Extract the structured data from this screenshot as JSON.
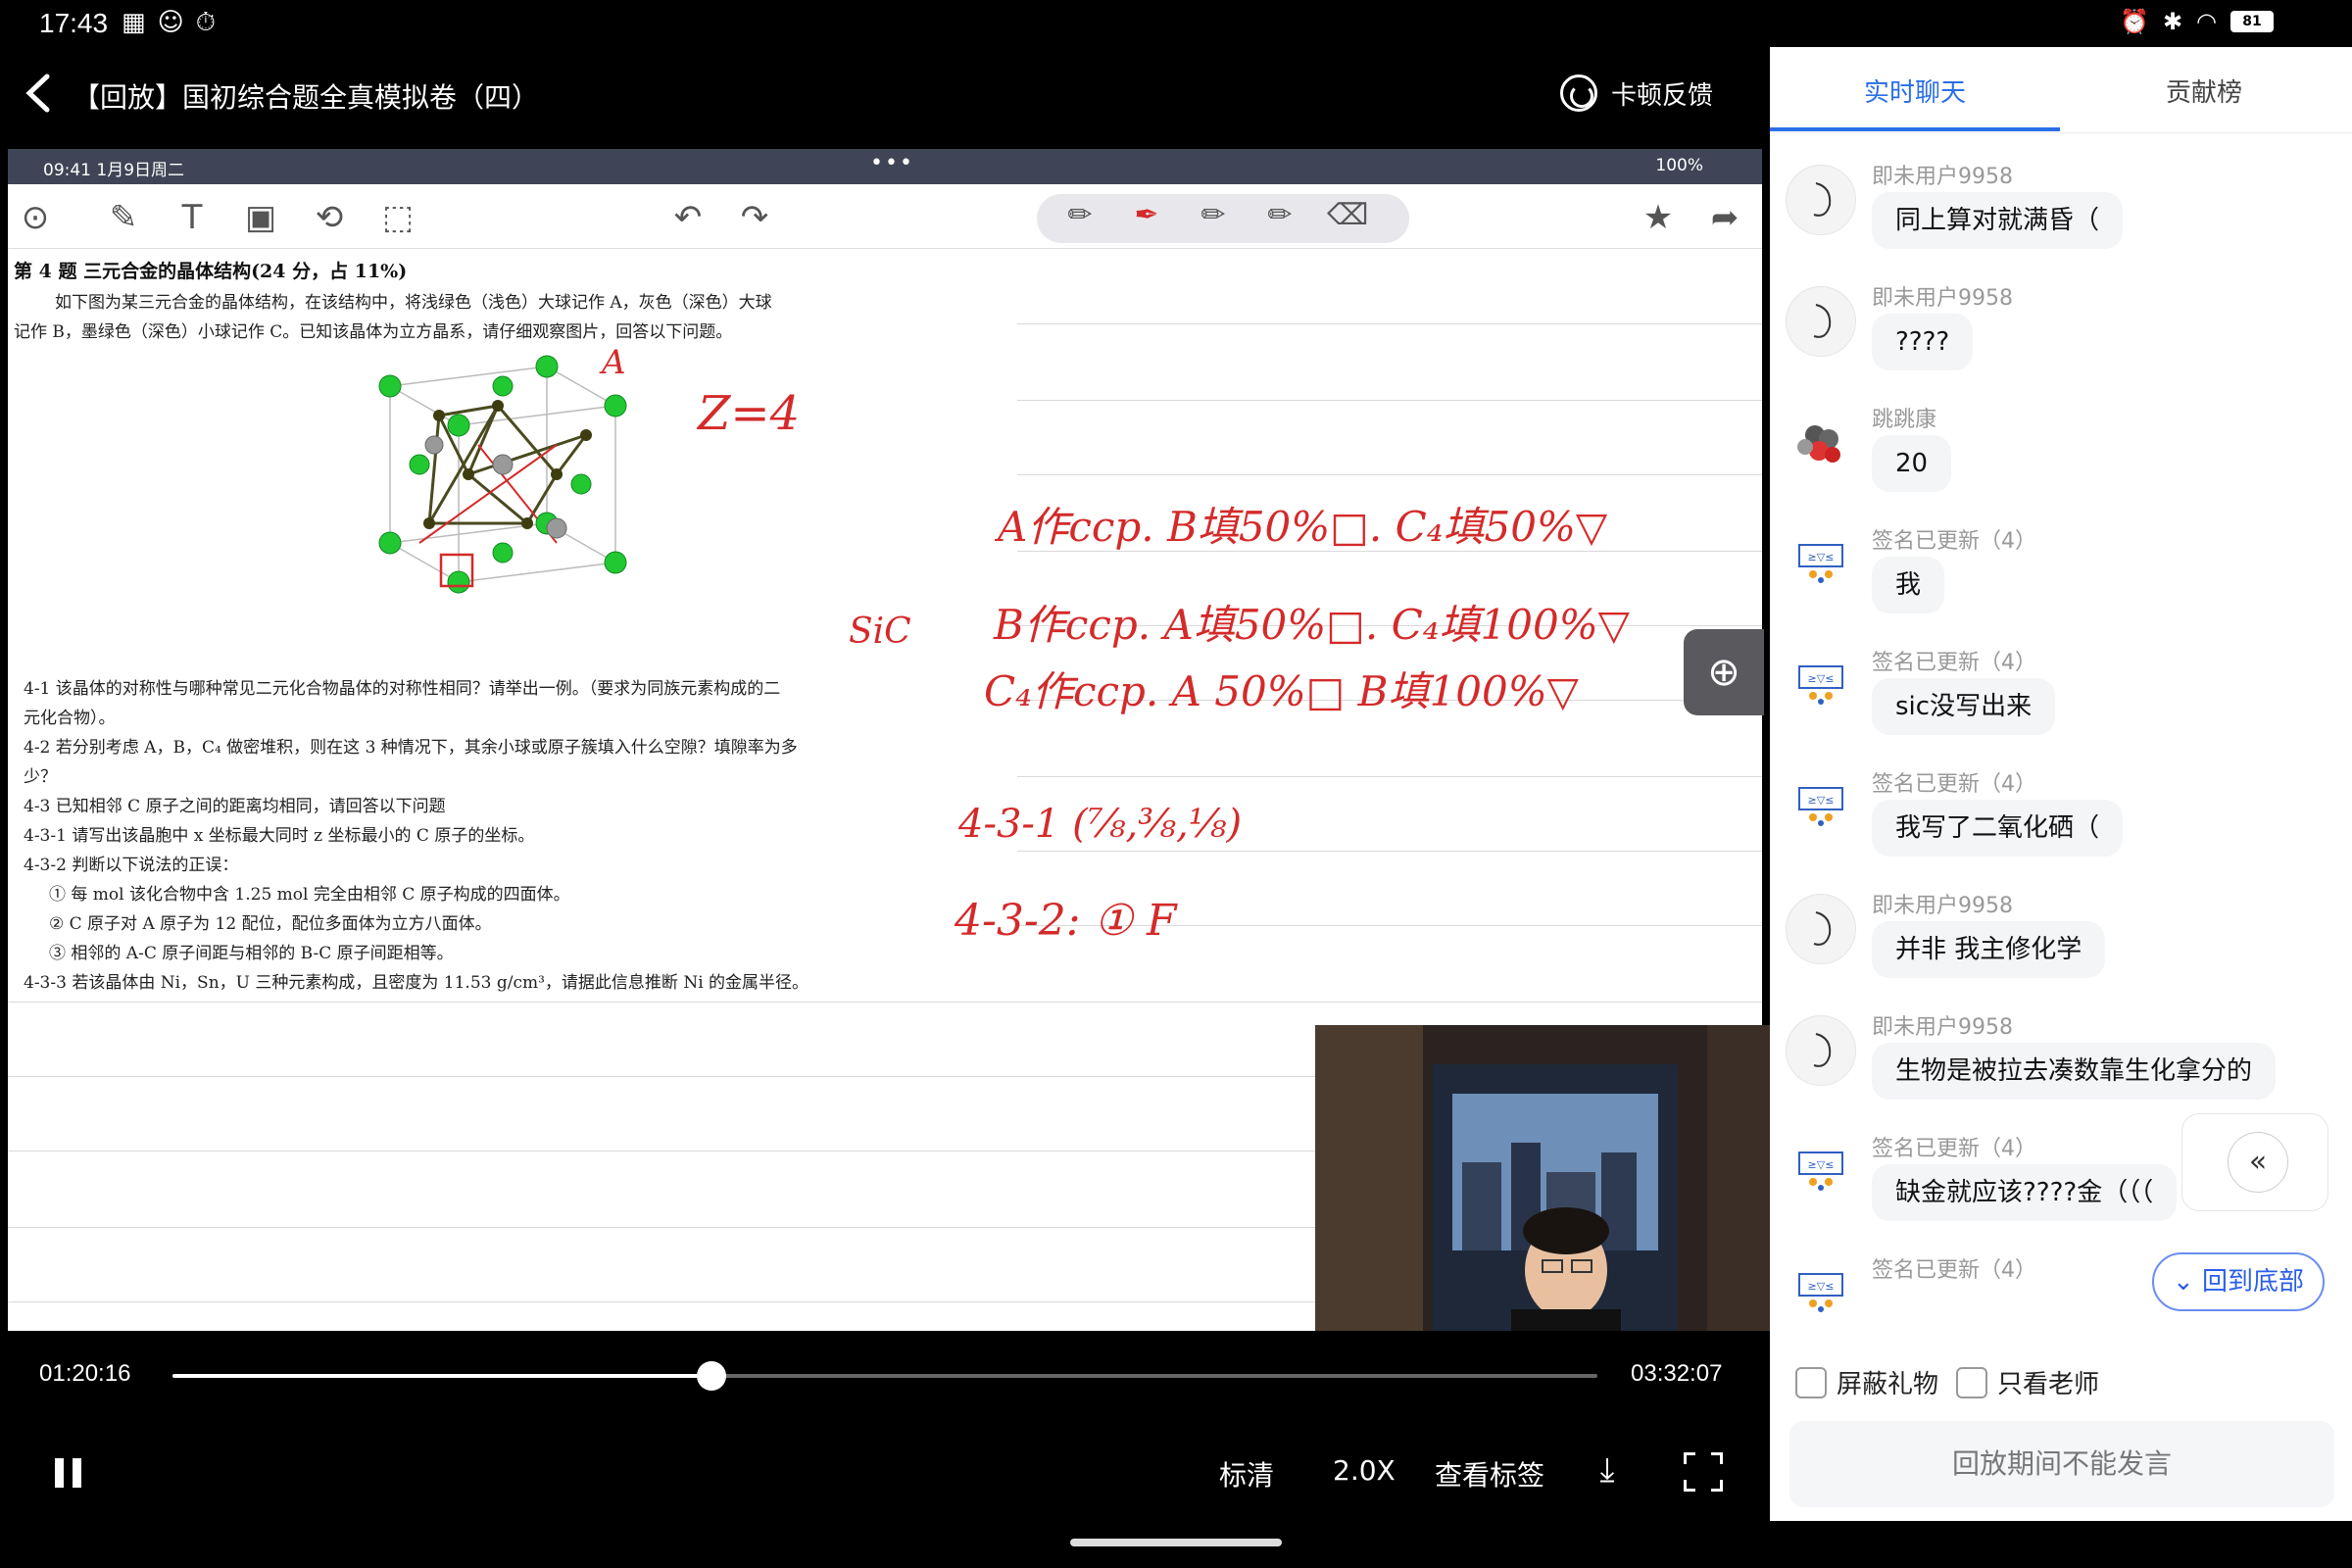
{
  "status": {
    "time": "17:43",
    "battery": "81"
  },
  "header": {
    "title": "【回放】国初综合题全真模拟卷（四）",
    "feedback_label": "卡顿反馈"
  },
  "ipad": {
    "time": "09:41  1月9日周二",
    "battery": "100%"
  },
  "doc": {
    "q_title": "第 4 题  三元合金的晶体结构(24 分，占 11%)",
    "intro_1": "如下图为某三元合金的晶体结构，在该结构中，将浅绿色（浅色）大球记作 A，灰色（深色）大球",
    "intro_2": "记作 B，墨绿色（深色）小球记作 C。已知该晶体为立方晶系，请仔细观察图片，回答以下问题。",
    "q41_a": "4-1  该晶体的对称性与哪种常见二元化合物晶体的对称性相同？请举出一例。（要求为同族元素构成的二",
    "q41_b": "元化合物）。",
    "q42_a": "4-2  若分别考虑 A，B，C₄ 做密堆积，则在这 3 种情况下，其余小球或原子簇填入什么空隙？填隙率为多",
    "q42_b": "少？",
    "q43": "4-3  已知相邻 C 原子之间的距离均相同，请回答以下问题",
    "q431": "4-3-1  请写出该晶胞中 x 坐标最大同时 z 坐标最小的 C 原子的坐标。",
    "q432": "4-3-2  判断以下说法的正误：",
    "q432_1": "① 每 mol 该化合物中含 1.25 mol 完全由相邻 C 原子构成的四面体。",
    "q432_2": "② C 原子对 A 原子为 12 配位，配位多面体为立方八面体。",
    "q432_3": "③ 相邻的 A-C 原子间距与相邻的 B-C 原子间距相等。",
    "q433": "4-3-3  若该晶体由 Ni，Sn，U 三种元素构成，且密度为 11.53 g/cm³，请据此信息推断 Ni 的金属半径。",
    "handwriting": {
      "a_label": "A",
      "z": "Z=4",
      "line1": "A作ccp.  B填50%□.  C₄填50%▽",
      "line2": "B作ccp.  A填50%□.  C₄填100%▽",
      "line3": "C₄作ccp.  A 50%□   B填100%▽",
      "sic": "SiC",
      "ans1": "4-3-1 (⅞,⅜,⅛)",
      "ans2": "4-3-2: ①  F"
    }
  },
  "player": {
    "current_time": "01:20:16",
    "total_time": "03:32:07",
    "progress": 0.378,
    "quality": "标清",
    "speed": "2.0X",
    "tags": "查看标签"
  },
  "chat": {
    "tabs": [
      "实时聊天",
      "贡献榜"
    ],
    "messages": [
      {
        "user": "即未用户9958",
        "text": "同上算对就满昏（",
        "avatar": "blank"
      },
      {
        "user": "即未用户9958",
        "text": "????",
        "avatar": "blank"
      },
      {
        "user": "跳跳康",
        "text": "20",
        "avatar": "molecule"
      },
      {
        "user": "签名已更新（4）",
        "text": "我",
        "avatar": "cat"
      },
      {
        "user": "签名已更新（4）",
        "text": "sic没写出来",
        "avatar": "cat"
      },
      {
        "user": "签名已更新（4）",
        "text": "我写了二氧化硒（",
        "avatar": "cat"
      },
      {
        "user": "即未用户9958",
        "text": "并非 我主修化学",
        "avatar": "blank"
      },
      {
        "user": "即未用户9958",
        "text": "生物是被拉去凑数靠生化拿分的",
        "avatar": "blank"
      },
      {
        "user": "签名已更新（4）",
        "text": "缺金就应该????金（（（",
        "avatar": "cat"
      },
      {
        "user": "签名已更新（4）",
        "text": "",
        "avatar": "cat"
      }
    ],
    "back_to_bottom": "回到底部",
    "block_gifts": "屏蔽礼物",
    "teacher_only": "只看老师",
    "no_speak": "回放期间不能发言"
  }
}
